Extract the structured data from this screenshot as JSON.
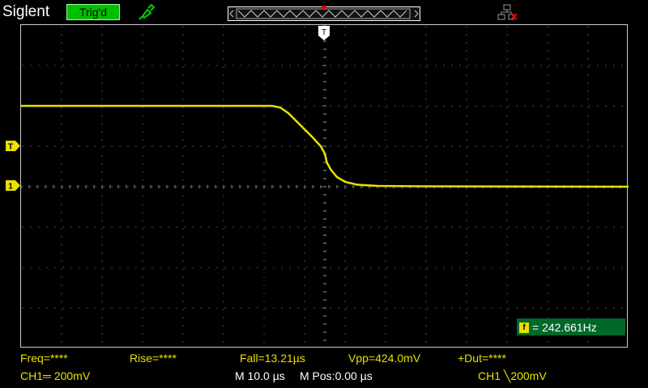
{
  "header": {
    "brand": "Siglent",
    "trigger_status": "Trig'd"
  },
  "colors": {
    "trace": "#e8e000",
    "trig_status_bg": "#00c000",
    "counter_bg": "#006828",
    "grid_dots": "#9a9a9a"
  },
  "icons": {
    "probe": "probe-icon",
    "usb": "usb-disconnected-icon",
    "trigger_level": "trigger-level-marker-icon",
    "ch1_ground": "ch1-ground-marker-icon",
    "trigger_time": "trigger-position-marker-icon"
  },
  "markers": {
    "trigger_level_label": "T",
    "ch1_label": "1",
    "time_label": "T"
  },
  "counter": {
    "badge": "f",
    "text": "= 242.661Hz"
  },
  "measurements": {
    "freq": "Freq=****",
    "rise": "Rise=****",
    "fall": "Fall=13.21µs",
    "vpp": "Vpp=424.0mV",
    "duty": "+Dut=****"
  },
  "status": {
    "ch1_scale": "CH1═ 200mV",
    "timebase": "M 10.0 µs",
    "mpos": "M Pos:0.00 µs",
    "trigger_info": "CH1 ╲200mV"
  },
  "chart_data": {
    "type": "line",
    "grid": true,
    "divisions": {
      "horizontal": 15,
      "vertical": 8
    },
    "series": [
      {
        "points_div": [
          [
            0.0,
            2.0
          ],
          [
            6.2,
            2.0
          ],
          [
            6.4,
            1.96
          ],
          [
            6.6,
            1.82
          ],
          [
            6.8,
            1.62
          ],
          [
            7.0,
            1.42
          ],
          [
            7.2,
            1.22
          ],
          [
            7.4,
            1.0
          ],
          [
            7.5,
            0.82
          ],
          [
            7.55,
            0.6
          ],
          [
            7.65,
            0.42
          ],
          [
            7.8,
            0.24
          ],
          [
            8.0,
            0.12
          ],
          [
            8.3,
            0.05
          ],
          [
            8.8,
            0.02
          ],
          [
            10.0,
            0.01
          ],
          [
            15.0,
            0.0
          ]
        ]
      }
    ]
  }
}
